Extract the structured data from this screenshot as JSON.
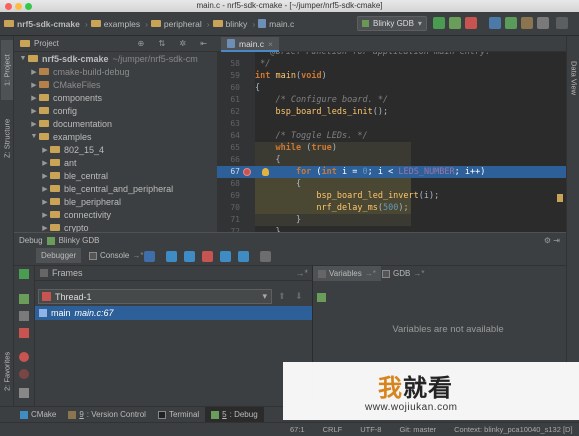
{
  "window": {
    "title": "main.c - nrf5-sdk-cmake - [~/jumper/nrf5-sdk-cmake]"
  },
  "navbar": {
    "breadcrumbs": [
      "nrf5-sdk-cmake",
      "examples",
      "peripheral",
      "blinky",
      "main.c"
    ],
    "run_config": "Blinky GDB"
  },
  "left_strip": {
    "project_tab": "1: Project",
    "structure_tab": "Z: Structure",
    "favorites_tab": "2: Favorites"
  },
  "right_strip": {
    "database_tab": "Data View"
  },
  "project_panel": {
    "header": "Project",
    "tree": [
      {
        "label": "nrf5-sdk-cmake",
        "path": "~/jumper/nrf5-sdk-cm",
        "indent": 0,
        "expanded": true,
        "bold": true
      },
      {
        "label": "cmake-build-debug",
        "indent": 1,
        "expanded": false,
        "dimmed": true
      },
      {
        "label": "CMakeFiles",
        "indent": 1,
        "expanded": false,
        "dimmed": true
      },
      {
        "label": "components",
        "indent": 1,
        "expanded": false
      },
      {
        "label": "config",
        "indent": 1,
        "expanded": false
      },
      {
        "label": "documentation",
        "indent": 1,
        "expanded": false
      },
      {
        "label": "examples",
        "indent": 1,
        "expanded": true
      },
      {
        "label": "802_15_4",
        "indent": 2,
        "expanded": false
      },
      {
        "label": "ant",
        "indent": 2,
        "expanded": false
      },
      {
        "label": "ble_central",
        "indent": 2,
        "expanded": false
      },
      {
        "label": "ble_central_and_peripheral",
        "indent": 2,
        "expanded": false
      },
      {
        "label": "ble_peripheral",
        "indent": 2,
        "expanded": false
      },
      {
        "label": "connectivity",
        "indent": 2,
        "expanded": false
      },
      {
        "label": "crypto",
        "indent": 2,
        "expanded": false
      }
    ]
  },
  "editor": {
    "tab": "main.c",
    "line_numbers": [
      "58",
      "59",
      "60",
      "61",
      "62",
      "63",
      "64",
      "65",
      "66",
      "67",
      "68",
      "69",
      "70",
      "71",
      "72",
      "73"
    ],
    "lines": [
      " * @brief Function for application main entry.",
      " */",
      "int main(void)",
      "{",
      "    /* Configure board. */",
      "    bsp_board_leds_init();",
      "",
      "    /* Toggle LEDs. */",
      "    while (true)",
      "    {",
      "        for (int i = 0; i < LEDS_NUMBER; i++)",
      "        {",
      "            bsp_board_led_invert(i);",
      "            nrf_delay_ms(500);",
      "        }",
      "    }",
      "}"
    ]
  },
  "debug": {
    "title_label": "Debug",
    "config": "Blinky GDB",
    "tabs": {
      "debugger": "Debugger",
      "console": "Console"
    },
    "frames_label": "Frames",
    "thread": "Thread-1",
    "frame_func": "main",
    "frame_loc": "main.c:67",
    "variables_label": "Variables",
    "gdb_label": "GDB",
    "vars_empty": "Variables are not available"
  },
  "tool_windows": [
    {
      "num": "",
      "label": "CMake"
    },
    {
      "num": "9",
      "label": ": Version Control"
    },
    {
      "num": "",
      "label": "Terminal"
    },
    {
      "num": "5",
      "label": ": Debug"
    }
  ],
  "status": {
    "position": "67:1",
    "line_sep": "CRLF",
    "encoding": "UTF-8",
    "git": "Git: master",
    "context": "Context: blinky_pca10040_s132 [D]"
  },
  "watermark": {
    "brand": "我就看",
    "url": "www.wojiukan.com"
  },
  "colors": {
    "accent": "#4a88c7",
    "exec_line": "#2d6099",
    "keyword": "#cc7832"
  }
}
